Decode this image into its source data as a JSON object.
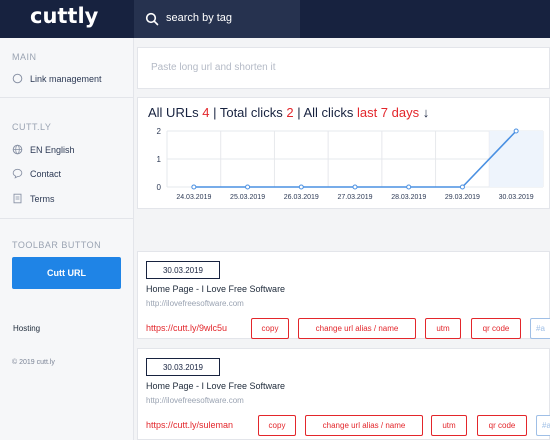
{
  "header": {
    "logo": "cuttly",
    "search_placeholder": "search by tag"
  },
  "sidebar": {
    "main_title": "MAIN",
    "link_management": "Link management",
    "cuttly_title": "CUTT.LY",
    "language": "EN English",
    "contact": "Contact",
    "terms": "Terms",
    "toolbar_title": "TOOLBAR BUTTON",
    "cutt_url_button": "Cutt URL",
    "hosting": "Hosting",
    "copyright": "© 2019 cutt.ly"
  },
  "shortener": {
    "placeholder": "Paste long url and shorten it"
  },
  "stats": {
    "all_urls_label": "All URLs",
    "all_urls_count": "4",
    "sep1": "|",
    "total_clicks_label": "Total clicks",
    "total_clicks_count": "2",
    "sep2": "|",
    "all_clicks_label": "All clicks",
    "period": "last 7 days",
    "arrow": "↓"
  },
  "chart_data": {
    "type": "line",
    "categories": [
      "24.03.2019",
      "25.03.2019",
      "26.03.2019",
      "27.03.2019",
      "28.03.2019",
      "29.03.2019",
      "30.03.2019"
    ],
    "values": [
      0,
      0,
      0,
      0,
      0,
      0,
      2
    ],
    "y_ticks": [
      "0",
      "1",
      "2"
    ],
    "ylim": [
      0,
      2
    ],
    "grid": true,
    "title": "",
    "xlabel": "",
    "ylabel": "",
    "color": "#4a90e2"
  },
  "links": [
    {
      "date": "30.03.2019",
      "title": "Home Page - I Love Free Software",
      "url": "http://ilovefreesoftware.com",
      "short": "https://cutt.ly/9wlc5u",
      "actions": [
        "copy",
        "change url alias / name",
        "utm",
        "qr code"
      ],
      "tag": "#a"
    },
    {
      "date": "30.03.2019",
      "title": "Home Page - I Love Free Software",
      "url": "http://ilovefreesoftware.com",
      "short": "https://cutt.ly/suleman",
      "actions": [
        "copy",
        "change url alias / name",
        "utm",
        "qr code"
      ],
      "tag": "#a"
    }
  ]
}
